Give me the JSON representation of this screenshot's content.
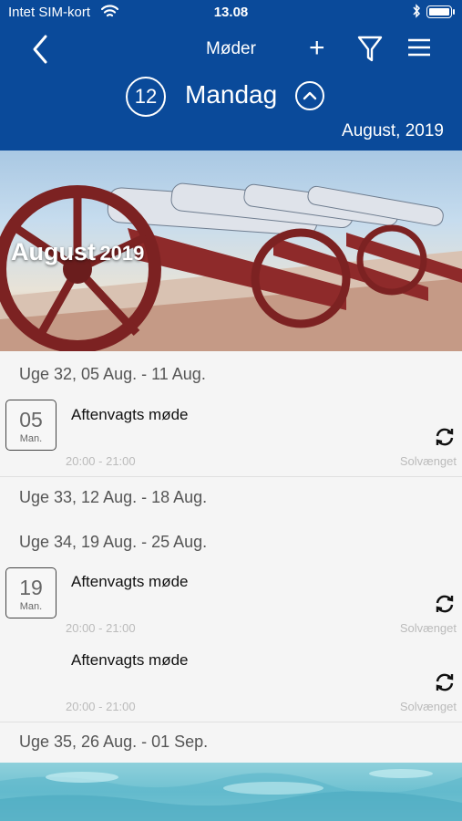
{
  "status": {
    "carrier": "Intet SIM-kort",
    "time": "13.08",
    "wifi_icon": "wifi-icon",
    "bluetooth_icon": "bluetooth-icon",
    "battery_icon": "battery-icon"
  },
  "nav": {
    "title": "Møder",
    "add_label": "+",
    "day_number": "12",
    "day_name": "Mandag",
    "month_year": "August, 2019",
    "colors": {
      "bar": "#0a4a9a",
      "text": "#ffffff"
    }
  },
  "hero": {
    "month": "August",
    "year": "2019"
  },
  "weeks": [
    "Uge 32, 05 Aug. - 11 Aug.",
    "Uge 33, 12 Aug. - 18 Aug.",
    "Uge 34, 19 Aug. - 25 Aug.",
    "Uge 35, 26 Aug. - 01 Sep."
  ],
  "events": [
    {
      "day": "05",
      "dayname": "Man.",
      "title": "Aftenvagts møde",
      "time": "20:00 - 21:00",
      "location": "Solvænget"
    },
    {
      "day": "19",
      "dayname": "Man.",
      "title": "Aftenvagts møde",
      "time": "20:00 - 21:00",
      "location": "Solvænget"
    },
    {
      "day": "",
      "dayname": "",
      "title": "Aftenvagts møde",
      "time": "20:00 - 21:00",
      "location": "Solvænget"
    }
  ]
}
